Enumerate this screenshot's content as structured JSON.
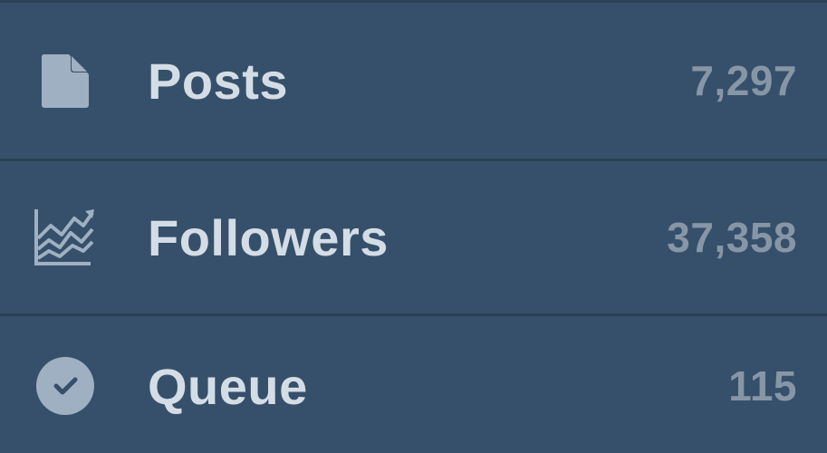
{
  "menu": {
    "items": [
      {
        "label": "Posts",
        "count": "7,297",
        "icon": "document-icon"
      },
      {
        "label": "Followers",
        "count": "37,358",
        "icon": "trending-chart-icon"
      },
      {
        "label": "Queue",
        "count": "115",
        "icon": "check-circle-icon"
      }
    ]
  },
  "colors": {
    "background": "#36506b",
    "divider": "#2b4057",
    "label": "#d4dde6",
    "count": "#8796a6",
    "icon": "#9fb0c2"
  }
}
